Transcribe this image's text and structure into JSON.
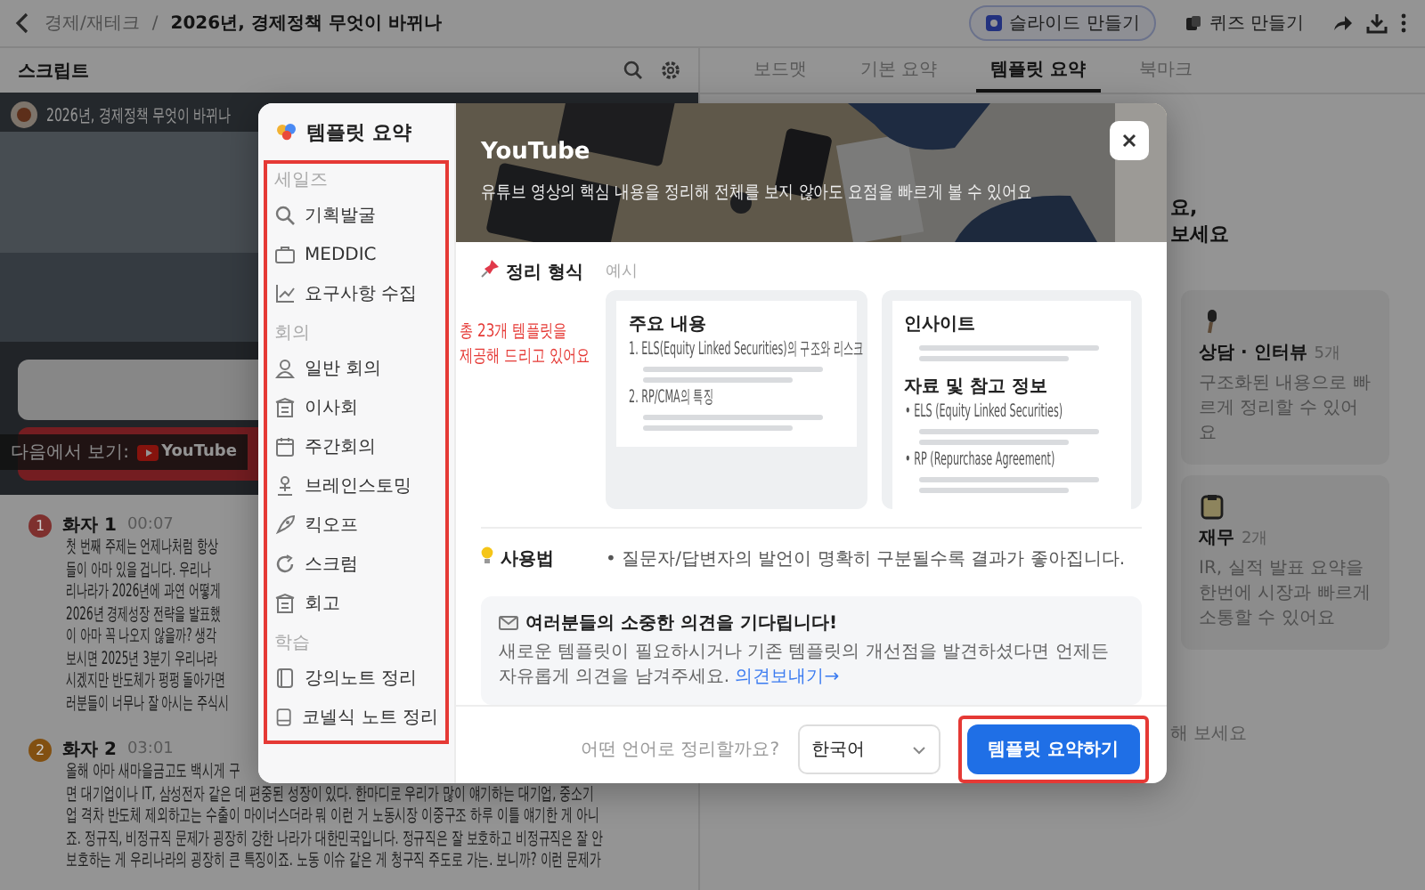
{
  "top_bar": {
    "breadcrumb": [
      "경제/재테크",
      "2026년, 경제정책 무엇이 바뀌나"
    ],
    "separator": "/",
    "actions": [
      {
        "label": "슬라이드 만들기",
        "kind": "outlined"
      },
      {
        "label": "퀴즈 만들기",
        "kind": "plain"
      }
    ]
  },
  "script_panel": {
    "title": "스크립트",
    "video": {
      "title": "2026년, 경제정책 무엇이 바뀌나",
      "watch_on": "다음에서 보기:",
      "platform": "YouTube"
    },
    "speakers": [
      {
        "badge": "1",
        "name": "화자 1",
        "time": "00:07",
        "color": "#7e302e",
        "lines": [
          "첫 번째 주제는 언제나처럼 항상",
          "들이 아마 있을 겁니다. 우리나",
          "리나라가 2026년에 과연 어떻게",
          "2026년 경제성장 전략을 발표했",
          "이 아마 꼭 나오지 않을까? 생각",
          "보시면 2025년 3분기 우리나라",
          "시겠지만 반도체가 펑펑 돌아가면",
          "러분들이 너무나 잘 아시는 주식시"
        ]
      },
      {
        "badge": "2",
        "name": "화자 2",
        "time": "03:01",
        "color": "#825011",
        "lines": [
          "올해 아마 새마을금고도 백시게 구",
          "면 대기업이나 IT, 삼성전자 같은 데 편중된 성장이 있다. 한마디로 우리가 많이 얘기하는 대기업, 중소기",
          "업 격차 반도체 제외하고는 수출이 마이너스더라 뭐 이런 거 노동시장 이중구조 하루 이틀 얘기한 게 아니",
          "죠. 정규직, 비정규직 문제가 굉장히 강한 나라가 대한민국입니다. 정규직은 잘 보호하고 비정규직은 잘 안",
          "보호하는 게 우리나라의 굉장히 큰 특징이죠. 노동 이슈 같은 게 청구직 주도로 가는. 보니까? 이런 문제가"
        ]
      }
    ]
  },
  "summary_panel": {
    "tabs": [
      {
        "label": "보드맷",
        "selected": false
      },
      {
        "label": "기본 요약",
        "selected": false
      },
      {
        "label": "템플릿 요약",
        "selected": true
      },
      {
        "label": "북마크",
        "selected": false
      }
    ],
    "heading_fragments": [
      "요,",
      "보세요"
    ],
    "cards": [
      {
        "title": "상담 · 인터뷰",
        "count": "5개",
        "description": "구조화된 내용으로 빠르게 정리할 수 있어요"
      },
      {
        "title": "재무",
        "count": "2개",
        "description": "IR, 실적 발표 요약을 한번에 시장과 빠르게 소통할 수 있어요"
      }
    ],
    "footer_fragment": "해 보세요"
  },
  "modal": {
    "sidebar": {
      "title": "템플릿 요약",
      "groups": [
        {
          "label": "세일즈",
          "items": [
            "기획발굴",
            "MEDDIC",
            "요구사항 수집"
          ]
        },
        {
          "label": "회의",
          "items": [
            "일반 회의",
            "이사회",
            "주간회의",
            "브레인스토밍",
            "킥오프",
            "스크럼",
            "회고"
          ]
        },
        {
          "label": "학습",
          "items": [
            "강의노트 정리",
            "코넬식 노트 정리"
          ]
        }
      ]
    },
    "header": {
      "title": "YouTube",
      "subtitle": "유튜브 영상의 핵심 내용을 정리해 전체를 보지 않아도 요점을 빠르게 볼 수 있어요"
    },
    "format": {
      "label": "정리 형식",
      "example_label": "예시",
      "examples": [
        {
          "sections": [
            {
              "heading": "주요 내용",
              "items": [
                "1. ELS(Equity Linked Securities)의 구조와 리스크",
                "2. RP/CMA의 특징"
              ]
            }
          ]
        },
        {
          "sections": [
            {
              "heading": "인사이트"
            },
            {
              "heading": "자료 및 참고 정보",
              "items": [
                "• ELS (Equity Linked Securities)",
                "• RP (Repurchase Agreement)"
              ]
            }
          ]
        }
      ]
    },
    "usage": {
      "label": "사용법",
      "tips": [
        "• 질문자/답변자의 발언이 명확히 구분될수록 결과가 좋아집니다."
      ]
    },
    "feedback": {
      "title": "여러분들의 소중한 의견을 기다립니다!",
      "text": "새로운 템플릿이 필요하시거나 기존 템플릿의 개선점을 발견하셨다면 언제든 자유롭게 의견을 남겨주세요.",
      "link": "의견보내기→"
    },
    "footer": {
      "question": "어떤 언어로 정리할까요?",
      "language": "한국어",
      "submit": "템플릿 요약하기"
    }
  },
  "annotation": {
    "note": "총 23개 템플릿을\n제공해 드리고 있어요"
  }
}
